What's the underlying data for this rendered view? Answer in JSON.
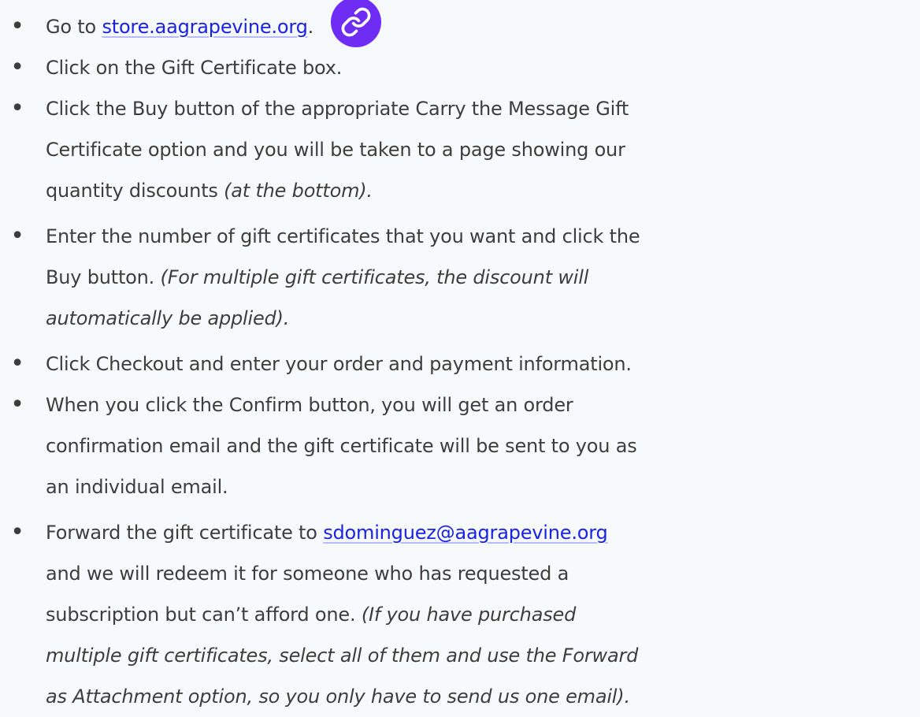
{
  "steps": [
    {
      "pre": "Go to ",
      "link": "store.aagrapevine.org",
      "post": ".",
      "badge_icon": "link-icon"
    },
    {
      "text": "Click on the Gift Certificate box."
    },
    {
      "line1": "Click the Buy button of the appropriate Carry the Message Gift",
      "line2": "Certificate option and you will be taken to a page showing our",
      "line3_plain": "quantity discounts ",
      "line3_italic": "(at the bottom)."
    },
    {
      "line1": "Enter the number of gift certificates that you want and click the",
      "line2_plain": "Buy button. ",
      "line2_italic": "(For multiple gift certificates, the discount will",
      "line3_italic": "automatically be applied)."
    },
    {
      "text": "Click Checkout and enter your order and payment information."
    },
    {
      "line1": "When you click the Confirm button, you will get an order",
      "line2": "confirmation email and the gift certificate will be sent to you as",
      "line3": "an individual email."
    },
    {
      "line1_plain": "Forward the gift certificate to ",
      "line1_link": "sdominguez@aagrapevine.org",
      "line2": "and we will redeem it for someone who has requested a",
      "line3_plain": "subscription but can’t afford one. ",
      "line3_italic": "(If you have purchased",
      "line4_italic": "multiple gift certificates, select all of them and use the Forward",
      "line5_italic": "as Attachment option, so you only have to send us one email)."
    }
  ],
  "bullet_glyph": "•",
  "colors": {
    "background": "#f7fafc",
    "text": "#3d3d3d",
    "link": "#1a22e6",
    "badge": "#6f2cf5"
  }
}
